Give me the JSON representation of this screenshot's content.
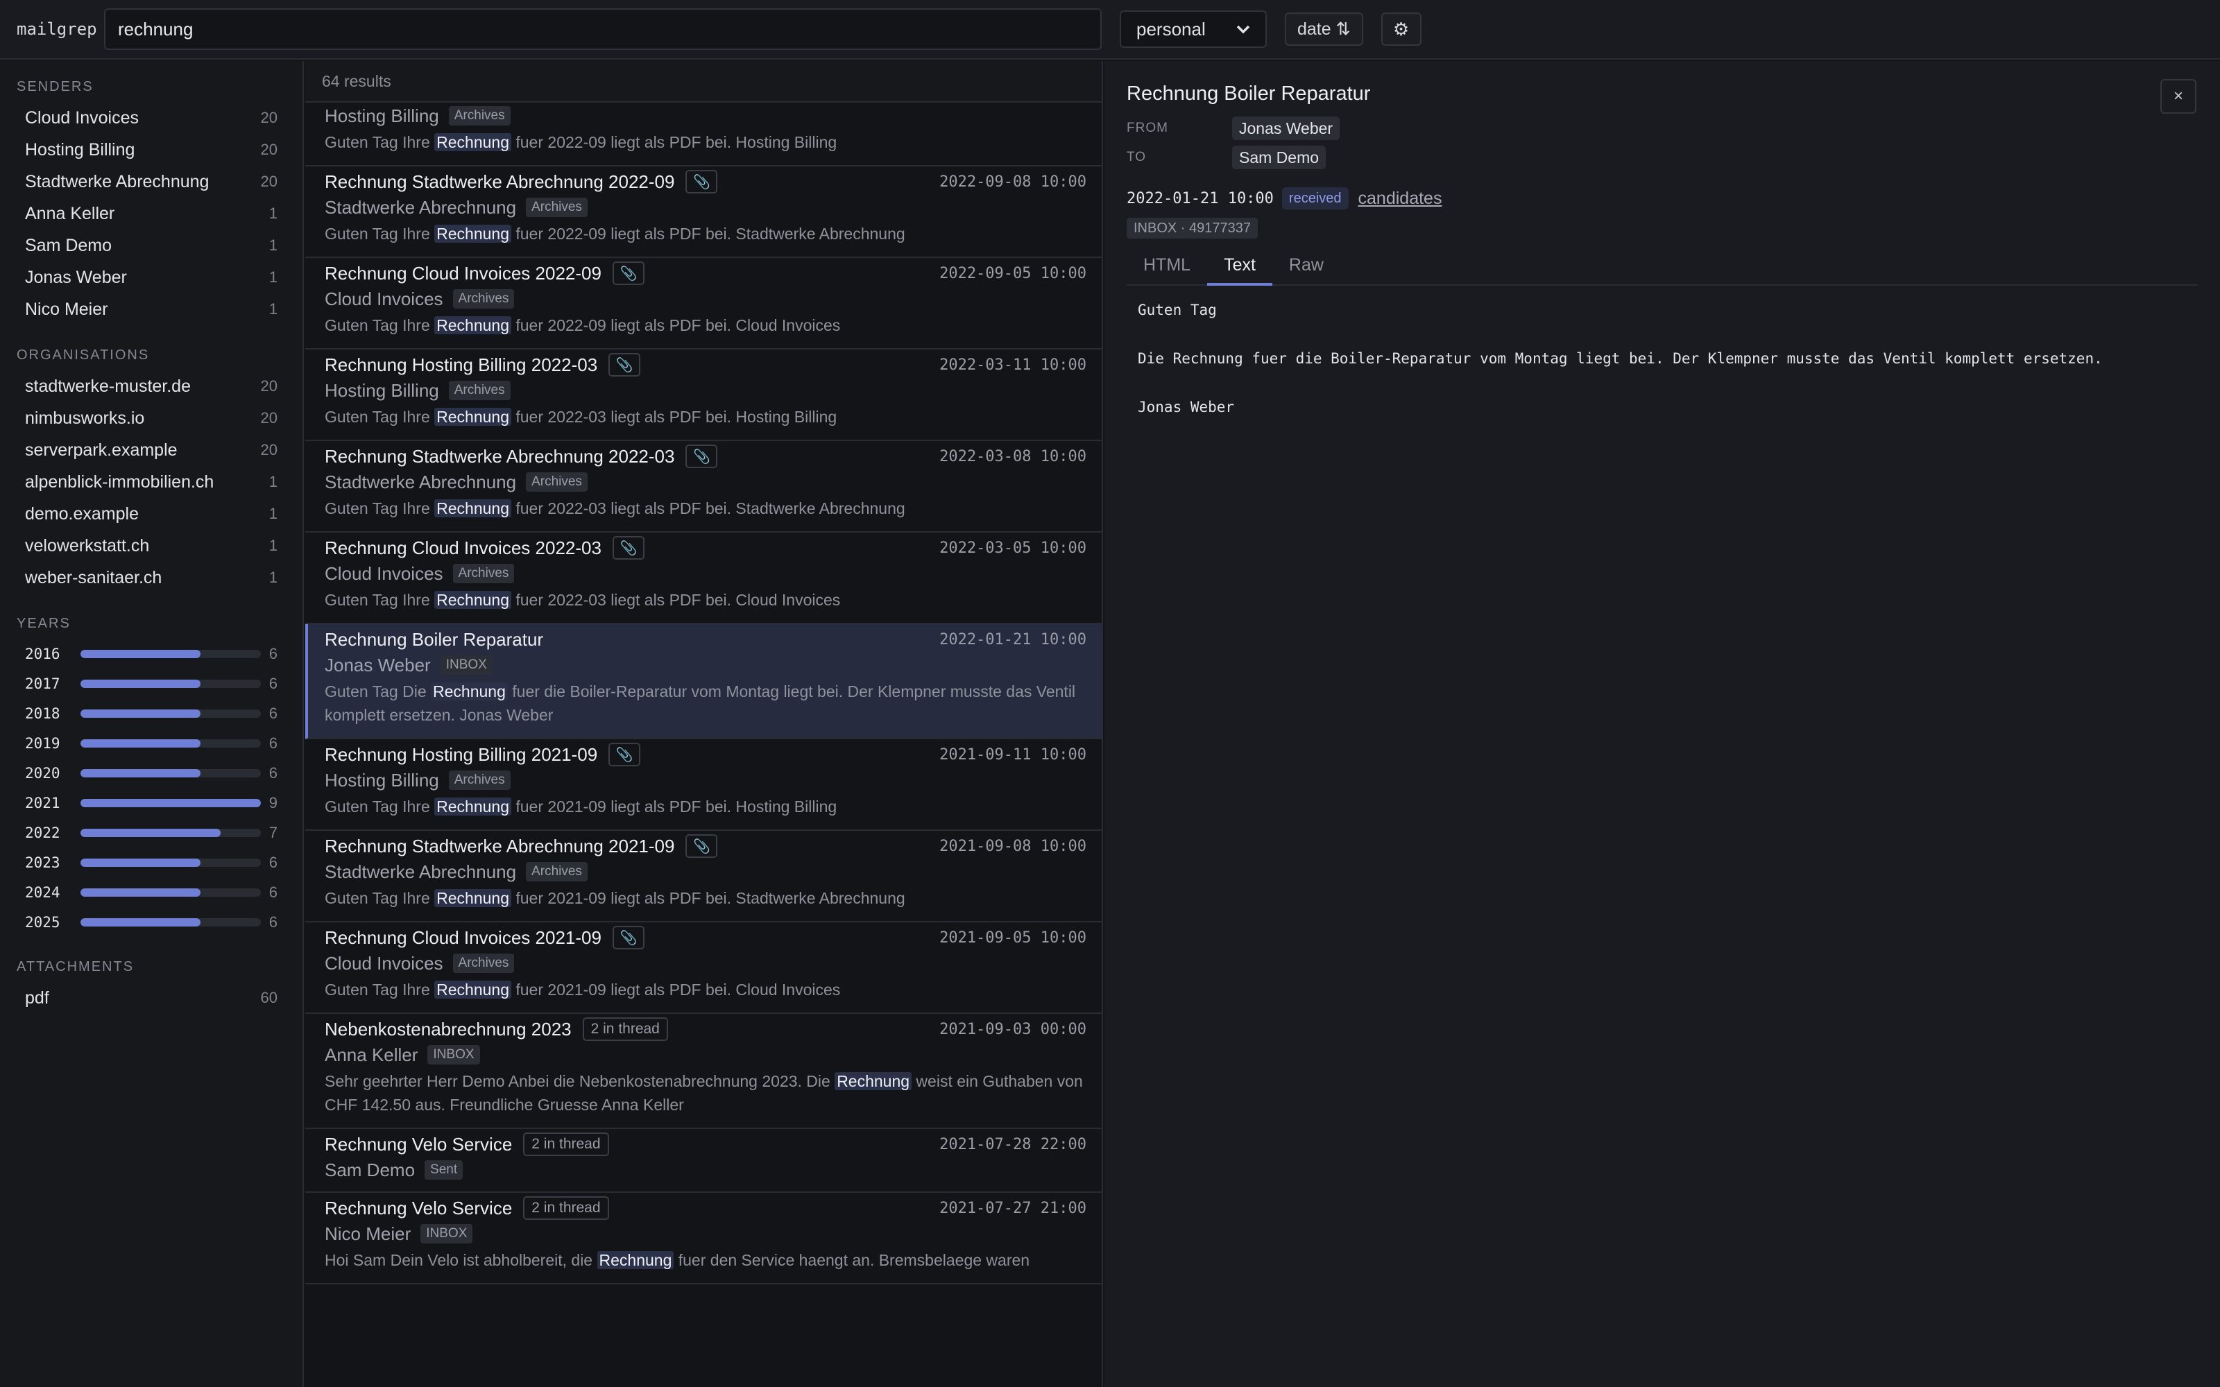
{
  "app": {
    "brand": "mailgrep"
  },
  "toolbar": {
    "query": "rechnung",
    "account": "personal",
    "sort_label": "date ⇅",
    "settings_icon": "gear-icon"
  },
  "sidebar": {
    "senders_title": "SENDERS",
    "senders": [
      {
        "label": "Cloud Invoices",
        "count": "20"
      },
      {
        "label": "Hosting Billing",
        "count": "20"
      },
      {
        "label": "Stadtwerke Abrechnung",
        "count": "20"
      },
      {
        "label": "Anna Keller",
        "count": "1"
      },
      {
        "label": "Sam Demo",
        "count": "1"
      },
      {
        "label": "Jonas Weber",
        "count": "1"
      },
      {
        "label": "Nico Meier",
        "count": "1"
      }
    ],
    "orgs_title": "ORGANISATIONS",
    "orgs": [
      {
        "label": "stadtwerke-muster.de",
        "count": "20"
      },
      {
        "label": "nimbusworks.io",
        "count": "20"
      },
      {
        "label": "serverpark.example",
        "count": "20"
      },
      {
        "label": "alpenblick-immobilien.ch",
        "count": "1"
      },
      {
        "label": "demo.example",
        "count": "1"
      },
      {
        "label": "velowerkstatt.ch",
        "count": "1"
      },
      {
        "label": "weber-sanitaer.ch",
        "count": "1"
      }
    ],
    "years_title": "YEARS",
    "years": [
      {
        "label": "2016",
        "count": "6",
        "fraction": 0.667
      },
      {
        "label": "2017",
        "count": "6",
        "fraction": 0.667
      },
      {
        "label": "2018",
        "count": "6",
        "fraction": 0.667
      },
      {
        "label": "2019",
        "count": "6",
        "fraction": 0.667
      },
      {
        "label": "2020",
        "count": "6",
        "fraction": 0.667
      },
      {
        "label": "2021",
        "count": "9",
        "fraction": 1.0
      },
      {
        "label": "2022",
        "count": "7",
        "fraction": 0.778
      },
      {
        "label": "2023",
        "count": "6",
        "fraction": 0.667
      },
      {
        "label": "2024",
        "count": "6",
        "fraction": 0.667
      },
      {
        "label": "2025",
        "count": "6",
        "fraction": 0.667
      }
    ],
    "attachments_title": "ATTACHMENTS",
    "attachments": [
      {
        "label": "pdf",
        "count": "60"
      }
    ]
  },
  "results": {
    "count_label": "64 results",
    "items": [
      {
        "subject": "",
        "attachment": false,
        "thread": "",
        "date": "",
        "sender": "Hosting Billing",
        "folder": "Archives",
        "snippet_pre": "Guten Tag Ihre ",
        "snippet_hit": "Rechnung",
        "snippet_post": " fuer 2022-09 liegt als PDF bei. Hosting Billing",
        "partial": true
      },
      {
        "subject": "Rechnung Stadtwerke Abrechnung 2022-09",
        "attachment": true,
        "thread": "",
        "date": "2022-09-08 10:00",
        "sender": "Stadtwerke Abrechnung",
        "folder": "Archives",
        "snippet_pre": "Guten Tag Ihre ",
        "snippet_hit": "Rechnung",
        "snippet_post": " fuer 2022-09 liegt als PDF bei. Stadtwerke Abrechnung"
      },
      {
        "subject": "Rechnung Cloud Invoices 2022-09",
        "attachment": true,
        "thread": "",
        "date": "2022-09-05 10:00",
        "sender": "Cloud Invoices",
        "folder": "Archives",
        "snippet_pre": "Guten Tag Ihre ",
        "snippet_hit": "Rechnung",
        "snippet_post": " fuer 2022-09 liegt als PDF bei. Cloud Invoices"
      },
      {
        "subject": "Rechnung Hosting Billing 2022-03",
        "attachment": true,
        "thread": "",
        "date": "2022-03-11 10:00",
        "sender": "Hosting Billing",
        "folder": "Archives",
        "snippet_pre": "Guten Tag Ihre ",
        "snippet_hit": "Rechnung",
        "snippet_post": " fuer 2022-03 liegt als PDF bei. Hosting Billing"
      },
      {
        "subject": "Rechnung Stadtwerke Abrechnung 2022-03",
        "attachment": true,
        "thread": "",
        "date": "2022-03-08 10:00",
        "sender": "Stadtwerke Abrechnung",
        "folder": "Archives",
        "snippet_pre": "Guten Tag Ihre ",
        "snippet_hit": "Rechnung",
        "snippet_post": " fuer 2022-03 liegt als PDF bei. Stadtwerke Abrechnung"
      },
      {
        "subject": "Rechnung Cloud Invoices 2022-03",
        "attachment": true,
        "thread": "",
        "date": "2022-03-05 10:00",
        "sender": "Cloud Invoices",
        "folder": "Archives",
        "snippet_pre": "Guten Tag Ihre ",
        "snippet_hit": "Rechnung",
        "snippet_post": " fuer 2022-03 liegt als PDF bei. Cloud Invoices"
      },
      {
        "subject": "Rechnung Boiler Reparatur",
        "attachment": false,
        "thread": "",
        "date": "2022-01-21 10:00",
        "sender": "Jonas Weber",
        "folder": "INBOX",
        "snippet_pre": "Guten Tag Die ",
        "snippet_hit": "Rechnung",
        "snippet_post": " fuer die Boiler-Reparatur vom Montag liegt bei. Der Klempner musste das Ventil komplett ersetzen. Jonas Weber",
        "selected": true
      },
      {
        "subject": "Rechnung Hosting Billing 2021-09",
        "attachment": true,
        "thread": "",
        "date": "2021-09-11 10:00",
        "sender": "Hosting Billing",
        "folder": "Archives",
        "snippet_pre": "Guten Tag Ihre ",
        "snippet_hit": "Rechnung",
        "snippet_post": " fuer 2021-09 liegt als PDF bei. Hosting Billing"
      },
      {
        "subject": "Rechnung Stadtwerke Abrechnung 2021-09",
        "attachment": true,
        "thread": "",
        "date": "2021-09-08 10:00",
        "sender": "Stadtwerke Abrechnung",
        "folder": "Archives",
        "snippet_pre": "Guten Tag Ihre ",
        "snippet_hit": "Rechnung",
        "snippet_post": " fuer 2021-09 liegt als PDF bei. Stadtwerke Abrechnung"
      },
      {
        "subject": "Rechnung Cloud Invoices 2021-09",
        "attachment": true,
        "thread": "",
        "date": "2021-09-05 10:00",
        "sender": "Cloud Invoices",
        "folder": "Archives",
        "snippet_pre": "Guten Tag Ihre ",
        "snippet_hit": "Rechnung",
        "snippet_post": " fuer 2021-09 liegt als PDF bei. Cloud Invoices"
      },
      {
        "subject": "Nebenkostenabrechnung 2023",
        "attachment": false,
        "thread": "2 in thread",
        "date": "2021-09-03 00:00",
        "sender": "Anna Keller",
        "folder": "INBOX",
        "snippet_pre": "Sehr geehrter Herr Demo Anbei die Nebenkostenabrechnung 2023. Die ",
        "snippet_hit": "Rechnung",
        "snippet_post": " weist ein Guthaben von CHF 142.50 aus. Freundliche Gruesse Anna Keller"
      },
      {
        "subject": "Rechnung Velo Service",
        "attachment": false,
        "thread": "2 in thread",
        "date": "2021-07-28 22:00",
        "sender": "Sam Demo",
        "folder": "Sent",
        "snippet_pre": "",
        "snippet_hit": "",
        "snippet_post": ""
      },
      {
        "subject": "Rechnung Velo Service",
        "attachment": false,
        "thread": "2 in thread",
        "date": "2021-07-27 21:00",
        "sender": "Nico Meier",
        "folder": "INBOX",
        "snippet_pre": "Hoi Sam Dein Velo ist abholbereit, die ",
        "snippet_hit": "Rechnung",
        "snippet_post": " fuer den Service haengt an. Bremsbelaege waren"
      }
    ]
  },
  "detail": {
    "title": "Rechnung Boiler Reparatur",
    "from_label": "FROM",
    "from": "Jonas Weber",
    "to_label": "TO",
    "to": "Sam Demo",
    "datetime": "2022-01-21 10:00",
    "direction": "received",
    "candidates_link": "candidates",
    "location": "INBOX · 49177337",
    "tabs": [
      "HTML",
      "Text",
      "Raw"
    ],
    "active_tab": 1,
    "body": [
      "Guten Tag",
      "Die Rechnung fuer die Boiler-Reparatur vom Montag liegt bei. Der Klempner musste das Ventil komplett ersetzen.",
      "Jonas Weber"
    ],
    "close_label": "×"
  },
  "colors": {
    "accent": "#6f7fd6",
    "selected_row": "#262b40",
    "background": "#131418"
  }
}
